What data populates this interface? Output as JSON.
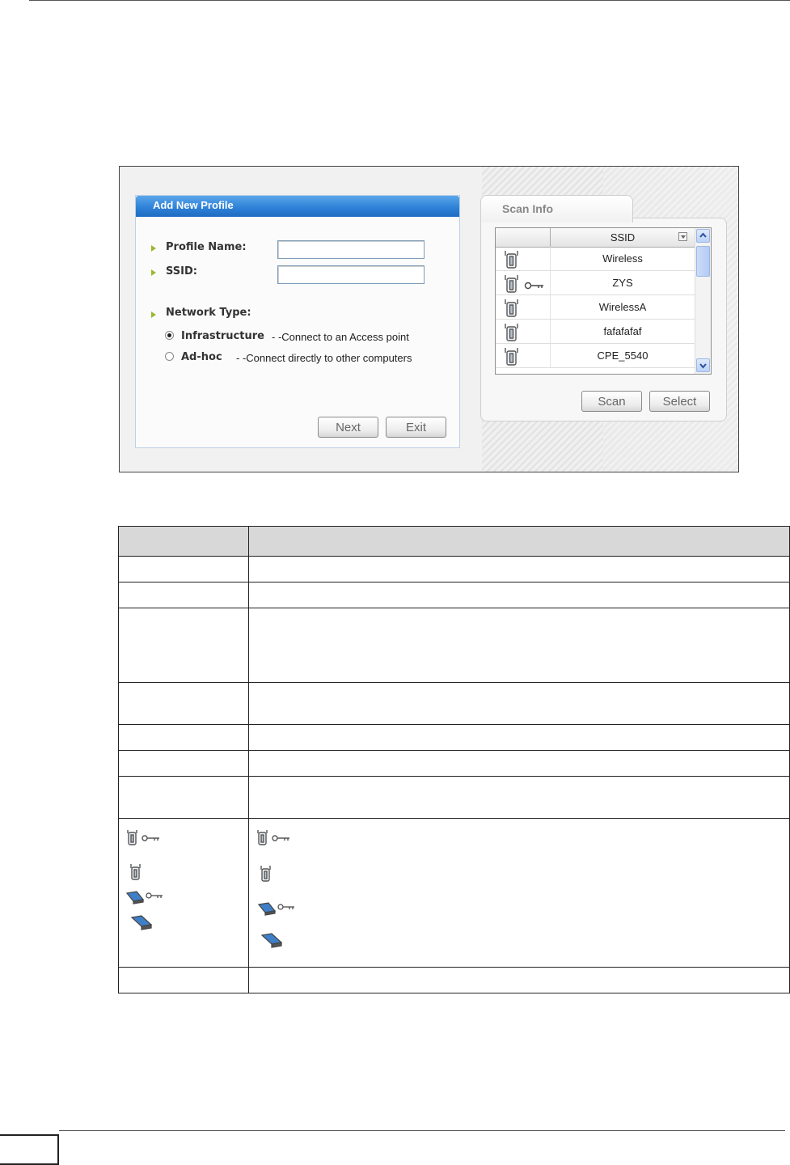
{
  "profile_dialog": {
    "title": "Add New Profile",
    "profile_name_label": "Profile Name:",
    "profile_name_value": "",
    "ssid_label": "SSID:",
    "ssid_value": "",
    "network_type_label": "Network Type:",
    "infrastructure_label": "Infrastructure",
    "infrastructure_desc": "- -Connect to an Access point",
    "infrastructure_selected": true,
    "adhoc_label": "Ad-hoc",
    "adhoc_desc": "- -Connect directly to other computers",
    "next_button": "Next",
    "exit_button": "Exit"
  },
  "scan_info": {
    "tab_label": "Scan Info",
    "column_header": "SSID",
    "networks": [
      {
        "ssid": "Wireless",
        "type": "access-point",
        "encrypted": false
      },
      {
        "ssid": "ZYS",
        "type": "access-point",
        "encrypted": true
      },
      {
        "ssid": "WirelessA",
        "type": "access-point",
        "encrypted": false
      },
      {
        "ssid": "fafafafaf",
        "type": "access-point",
        "encrypted": false
      },
      {
        "ssid": "CPE_5540",
        "type": "access-point",
        "encrypted": false
      }
    ],
    "scan_button": "Scan",
    "select_button": "Select"
  },
  "colors": {
    "header_blue": "#2c7fd6",
    "bullet_green": "#9ab930",
    "table_header": "#d8d8d8"
  },
  "icons": [
    "access-point-icon",
    "key-icon",
    "network-card-icon"
  ]
}
